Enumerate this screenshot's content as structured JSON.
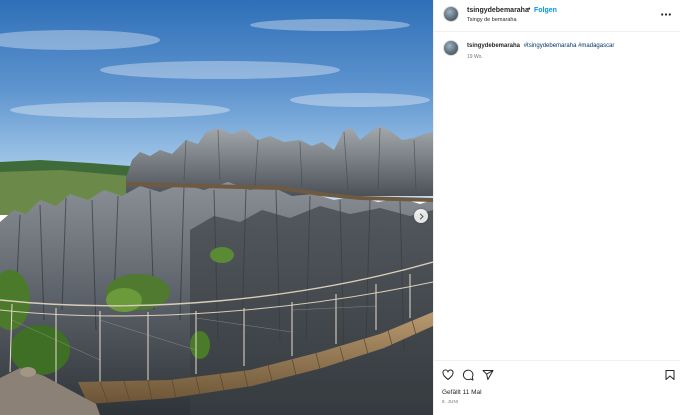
{
  "post": {
    "username": "tsingydebemaraha",
    "separator": "•",
    "follow_label": "Folgen",
    "location": "Tsingy de bemaraha",
    "more_icon": "more-horizontal-icon"
  },
  "caption": {
    "username": "tsingydebemaraha",
    "hashtags": [
      "#tsingydebemaraha",
      "#madagascar"
    ],
    "age": "19 Wo."
  },
  "actions": {
    "like_icon": "heart-icon",
    "comment_icon": "comment-icon",
    "share_icon": "share-icon",
    "save_icon": "bookmark-icon",
    "likes_text": "Gefällt 11 Mal",
    "date": "8. JUNI"
  },
  "media": {
    "next_icon": "chevron-right-icon"
  },
  "colors": {
    "accent": "#0095f6",
    "hashtag": "#00376b",
    "text": "#262626",
    "muted": "#737373"
  }
}
